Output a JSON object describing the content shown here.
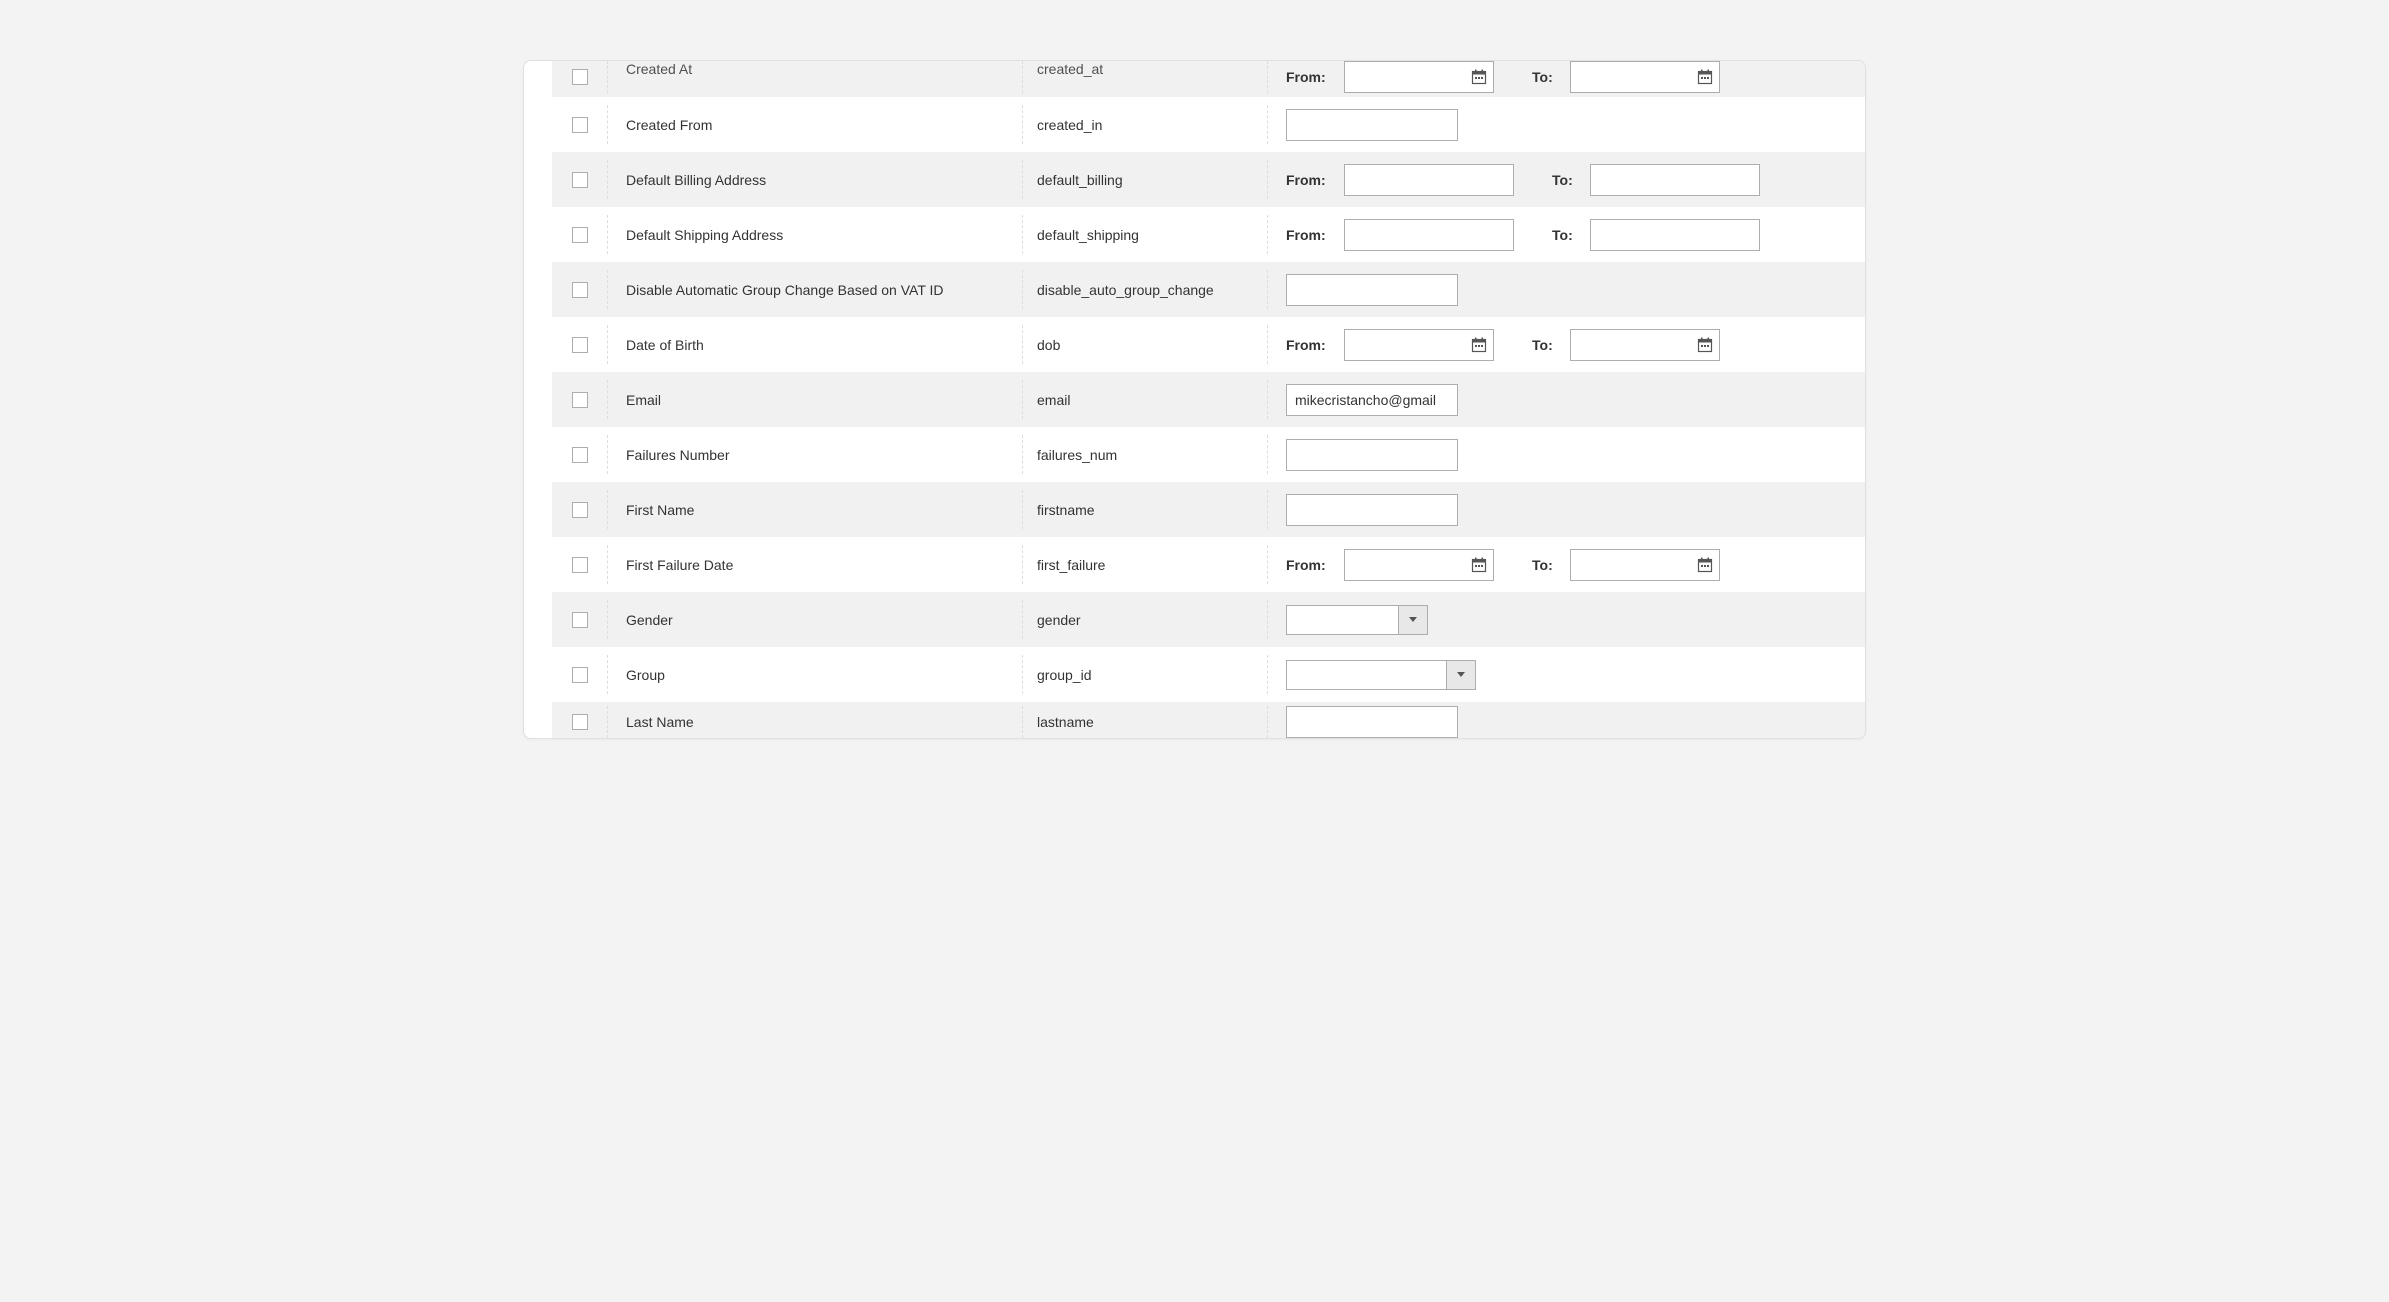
{
  "labels": {
    "from": "From:",
    "to": "To:"
  },
  "rows": [
    {
      "checked": false,
      "label": "Created At",
      "code": "created_at",
      "type": "date_range",
      "alt": true,
      "cutoff": "top"
    },
    {
      "checked": false,
      "label": "Created From",
      "code": "created_in",
      "type": "text",
      "value": "",
      "alt": false
    },
    {
      "checked": false,
      "label": "Default Billing Address",
      "code": "default_billing",
      "type": "range",
      "alt": true
    },
    {
      "checked": false,
      "label": "Default Shipping Address",
      "code": "default_shipping",
      "type": "range",
      "alt": false
    },
    {
      "checked": false,
      "label": "Disable Automatic Group Change Based on VAT ID",
      "code": "disable_auto_group_change",
      "type": "text",
      "value": "",
      "alt": true
    },
    {
      "checked": false,
      "label": "Date of Birth",
      "code": "dob",
      "type": "date_range",
      "alt": false
    },
    {
      "checked": false,
      "label": "Email",
      "code": "email",
      "type": "text",
      "value": "mikecristancho@gmail",
      "alt": true
    },
    {
      "checked": false,
      "label": "Failures Number",
      "code": "failures_num",
      "type": "text",
      "value": "",
      "alt": false
    },
    {
      "checked": false,
      "label": "First Name",
      "code": "firstname",
      "type": "text",
      "value": "",
      "alt": true
    },
    {
      "checked": false,
      "label": "First Failure Date",
      "code": "first_failure",
      "type": "date_range",
      "alt": false
    },
    {
      "checked": false,
      "label": "Gender",
      "code": "gender",
      "type": "select",
      "alt": true
    },
    {
      "checked": false,
      "label": "Group",
      "code": "group_id",
      "type": "select_wide",
      "alt": false
    },
    {
      "checked": false,
      "label": "Last Name",
      "code": "lastname",
      "type": "text",
      "value": "",
      "alt": true,
      "cutoff": "bottom"
    }
  ]
}
